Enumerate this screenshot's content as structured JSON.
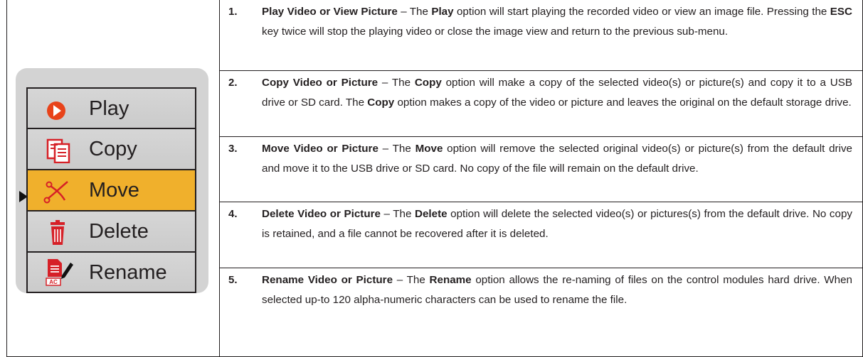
{
  "menu": {
    "items": [
      {
        "label": "Play",
        "icon": "play-icon"
      },
      {
        "label": "Copy",
        "icon": "copy-icon"
      },
      {
        "label": "Move",
        "icon": "scissors-icon",
        "selected": true
      },
      {
        "label": "Delete",
        "icon": "trash-icon"
      },
      {
        "label": "Rename",
        "icon": "rename-icon",
        "badge": "AC"
      }
    ],
    "selected_color": "#f0b02c"
  },
  "rows": [
    {
      "number": "1.",
      "parts": [
        {
          "t": "Play Video or View Picture",
          "b": true
        },
        {
          "t": " – The "
        },
        {
          "t": "Play",
          "b": true
        },
        {
          "t": " option will start playing the recorded video or view an image file. Pressing the "
        },
        {
          "t": "ESC",
          "b": true
        },
        {
          "t": " key twice will stop the playing video or close the image view and return to the previous sub-menu."
        }
      ]
    },
    {
      "number": "2.",
      "parts": [
        {
          "t": "Copy Video or Picture",
          "b": true
        },
        {
          "t": " – The "
        },
        {
          "t": "Copy",
          "b": true
        },
        {
          "t": " option will make a copy of the selected video(s) or picture(s) and copy it to a USB drive or SD card. The "
        },
        {
          "t": "Copy",
          "b": true
        },
        {
          "t": " option makes a copy of the video or picture and leaves the original on the default storage drive."
        }
      ]
    },
    {
      "number": "3.",
      "parts": [
        {
          "t": "Move Video or Picture",
          "b": true
        },
        {
          "t": " – The "
        },
        {
          "t": "Move",
          "b": true
        },
        {
          "t": " option will remove the selected original video(s) or picture(s) from the default drive and move it to the USB drive or SD card. No copy of the file will remain on the default drive."
        }
      ]
    },
    {
      "number": "4.",
      "parts": [
        {
          "t": "Delete Video or Picture",
          "b": true
        },
        {
          "t": " – The "
        },
        {
          "t": "Delete",
          "b": true
        },
        {
          "t": " option will delete the selected video(s) or pictures(s) from the default drive. No copy is retained, and a file cannot be recovered after it is deleted."
        }
      ]
    },
    {
      "number": "5.",
      "parts": [
        {
          "t": "Rename Video or Picture",
          "b": true
        },
        {
          "t": " – The "
        },
        {
          "t": "Rename",
          "b": true
        },
        {
          "t": " option allows the re-naming of files on the control modules hard drive. When selected up-to 120 alpha-numeric characters can be used to rename the file."
        }
      ]
    }
  ]
}
